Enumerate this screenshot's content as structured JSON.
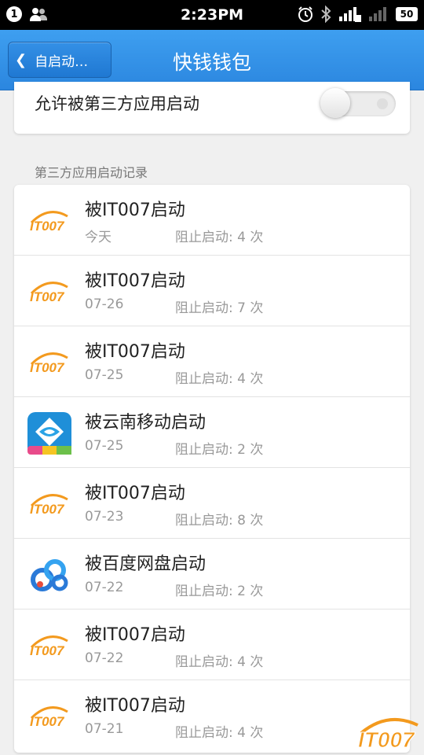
{
  "status_bar": {
    "notification_count": "1",
    "time": "2:23PM",
    "battery": "50"
  },
  "header": {
    "back_label": "自启动…",
    "title": "快钱钱包"
  },
  "toggle": {
    "label": "允许被第三方应用启动",
    "enabled": false
  },
  "section_label": "第三方应用启动记录",
  "records": [
    {
      "title": "被IT007启动",
      "date": "今天",
      "count": "阻止启动: 4 次",
      "icon": "it007-icon"
    },
    {
      "title": "被IT007启动",
      "date": "07-26",
      "count": "阻止启动: 7 次",
      "icon": "it007-icon"
    },
    {
      "title": "被IT007启动",
      "date": "07-25",
      "count": "阻止启动: 4 次",
      "icon": "it007-icon"
    },
    {
      "title": "被云南移动启动",
      "date": "07-25",
      "count": "阻止启动: 2 次",
      "icon": "china-mobile-icon"
    },
    {
      "title": "被IT007启动",
      "date": "07-23",
      "count": "阻止启动: 8 次",
      "icon": "it007-icon"
    },
    {
      "title": "被百度网盘启动",
      "date": "07-22",
      "count": "阻止启动: 2 次",
      "icon": "baidu-netdisk-icon"
    },
    {
      "title": "被IT007启动",
      "date": "07-22",
      "count": "阻止启动: 4 次",
      "icon": "it007-icon"
    },
    {
      "title": "被IT007启动",
      "date": "07-21",
      "count": "阻止启动: 4 次",
      "icon": "it007-icon"
    }
  ],
  "it007_logo_text": "IT007",
  "watermark_text": "IT007",
  "colors": {
    "header_blue": "#2b86df",
    "it007_orange": "#f39a1e"
  }
}
